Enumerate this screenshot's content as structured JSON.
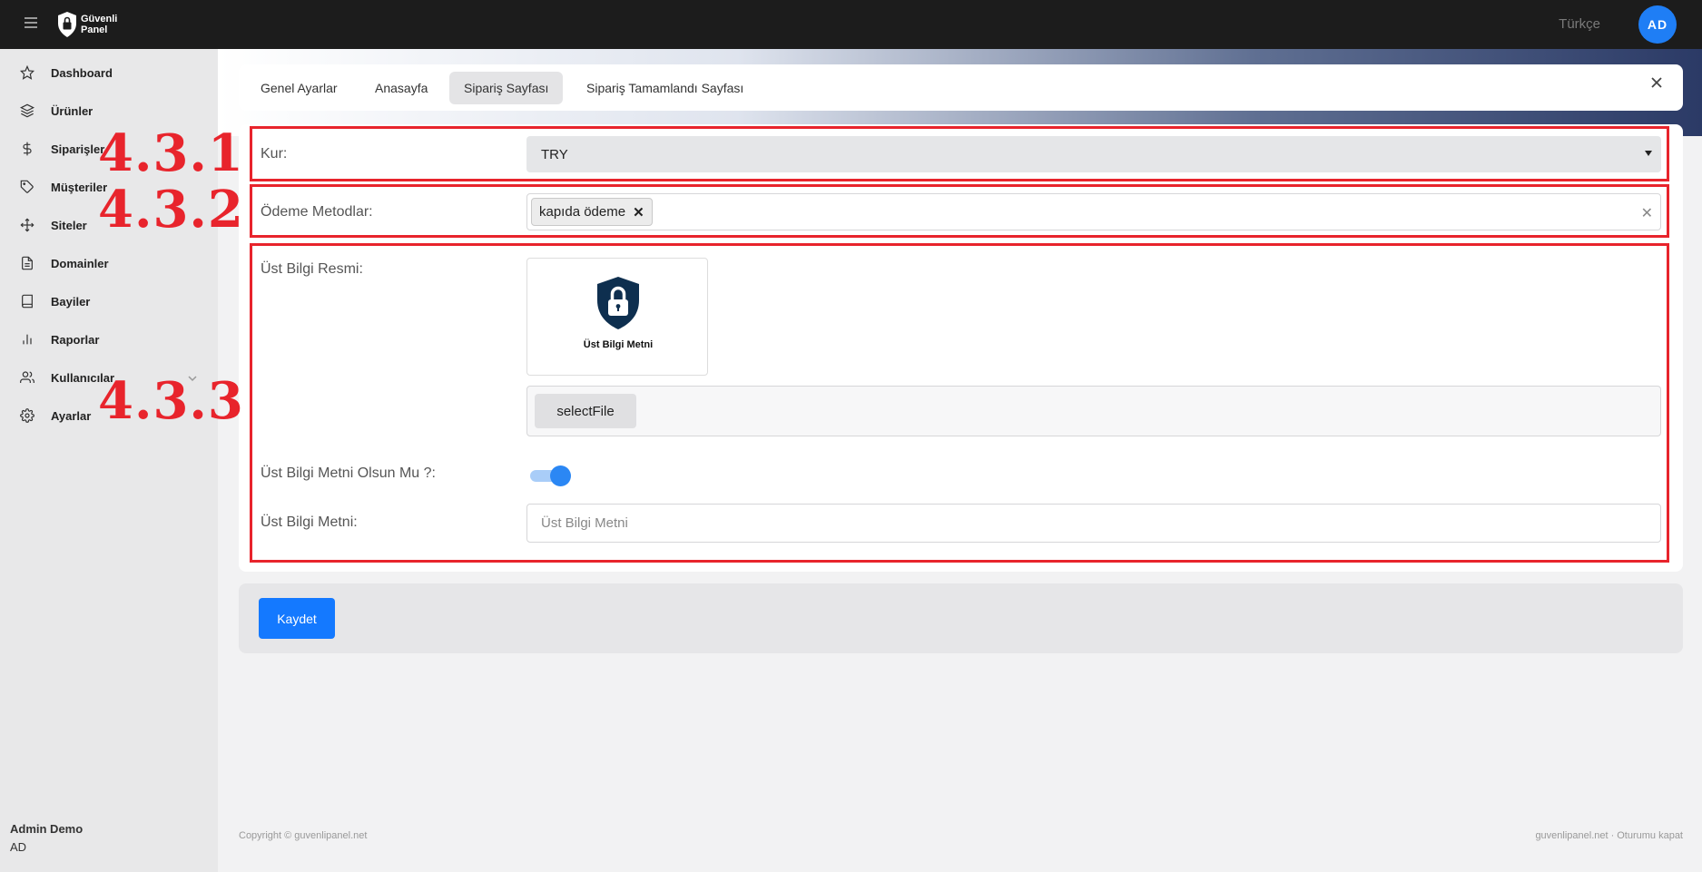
{
  "topbar": {
    "logo_line1": "Güvenli",
    "logo_line2": "Panel",
    "language": "Türkçe",
    "avatar_initials": "AD"
  },
  "sidebar": {
    "items": [
      {
        "label": "Dashboard",
        "icon": "star-icon"
      },
      {
        "label": "Ürünler",
        "icon": "layers-icon"
      },
      {
        "label": "Siparişler",
        "icon": "dollar-icon"
      },
      {
        "label": "Müşteriler",
        "icon": "tag-icon"
      },
      {
        "label": "Siteler",
        "icon": "move-icon"
      },
      {
        "label": "Domainler",
        "icon": "file-icon"
      },
      {
        "label": "Bayiler",
        "icon": "book-icon"
      },
      {
        "label": "Raporlar",
        "icon": "bar-chart-icon"
      },
      {
        "label": "Kullanıcılar",
        "icon": "users-icon"
      },
      {
        "label": "Ayarlar",
        "icon": "gear-icon"
      }
    ],
    "user_name": "Admin Demo",
    "user_initials": "AD"
  },
  "tabs": [
    {
      "label": "Genel Ayarlar",
      "active": false
    },
    {
      "label": "Anasayfa",
      "active": false
    },
    {
      "label": "Sipariş Sayfası",
      "active": true
    },
    {
      "label": "Sipariş Tamamlandı Sayfası",
      "active": false
    }
  ],
  "form": {
    "currency_label": "Kur:",
    "currency_value": "TRY",
    "payment_label": "Ödeme Metodlar:",
    "payment_tags": [
      "kapıda ödeme"
    ],
    "header_image_label": "Üst Bilgi Resmi:",
    "header_image_caption": "Üst Bilgi Metni",
    "select_file_label": "selectFile",
    "header_text_toggle_label": "Üst Bilgi Metni Olsun Mu ?:",
    "header_text_toggle_on": true,
    "header_text_label": "Üst Bilgi Metni:",
    "header_text_placeholder": "Üst Bilgi Metni",
    "header_text_value": ""
  },
  "annotations": [
    "4.3.1",
    "4.3.2",
    "4.3.3"
  ],
  "save_label": "Kaydet",
  "footer": {
    "copyright": "Copyright © guvenlipanel.net",
    "site": "guvenlipanel.net",
    "separator": "·",
    "logout": "Oturumu kapat"
  },
  "colors": {
    "accent": "#1479ff",
    "annotation": "#e8242c",
    "topbar": "#1c1c1c",
    "sidebar": "#e8e8e9"
  }
}
